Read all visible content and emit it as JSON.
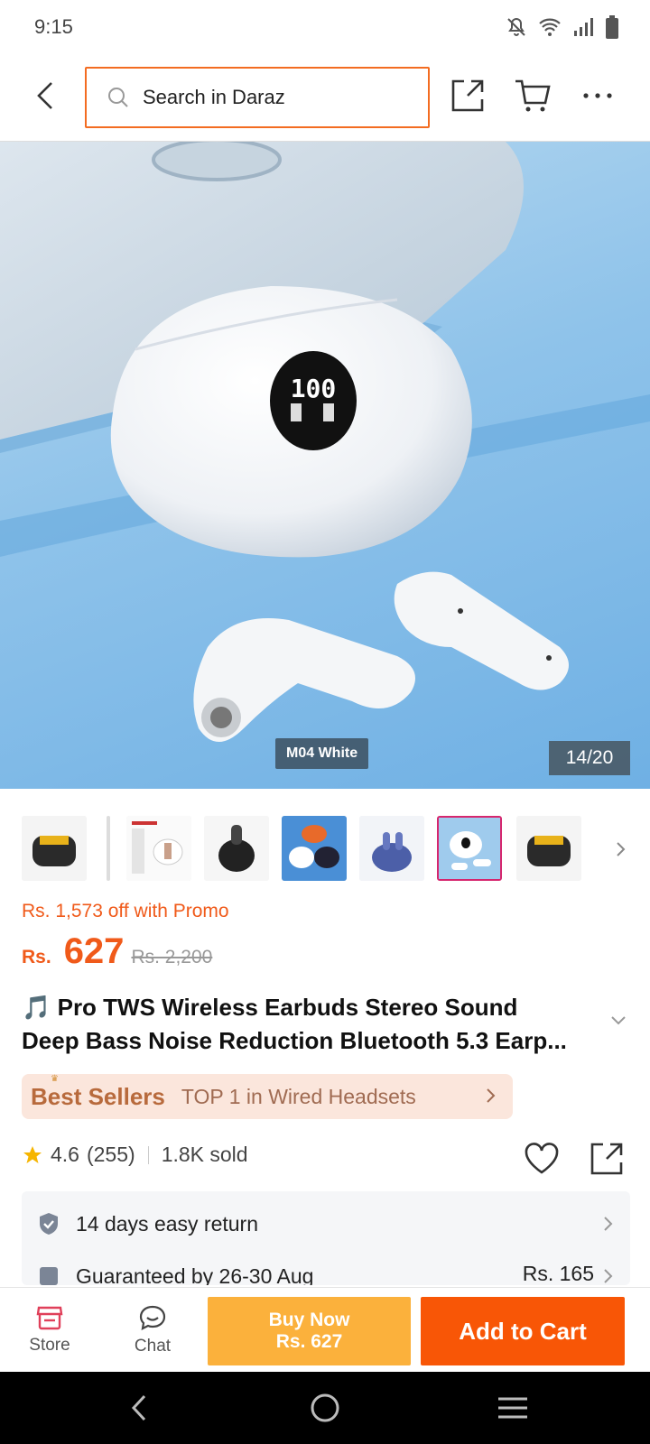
{
  "status_bar": {
    "time": "9:15"
  },
  "search": {
    "placeholder": "Search in Daraz"
  },
  "gallery": {
    "variant_label": "M04 White",
    "counter": "14/20"
  },
  "price": {
    "promo": "Rs. 1,573 off with Promo",
    "currency": "Rs.",
    "current": "627",
    "original": "Rs. 2,200"
  },
  "product": {
    "title_line1": "🎵 Pro TWS Wireless Earbuds Stereo Sound",
    "title_line2": "Deep Bass Noise Reduction Bluetooth 5.3 Earp..."
  },
  "best_seller": {
    "title": "Best Sellers",
    "rank": "TOP 1 in Wired Headsets"
  },
  "rating": {
    "value": "4.6",
    "count": "(255)",
    "sold": "1.8K sold"
  },
  "services": {
    "return": "14 days easy return",
    "delivery": "Guaranteed by 26-30 Aug",
    "fee": "Rs. 165"
  },
  "actions": {
    "store": "Store",
    "chat": "Chat",
    "buy_now_line1": "Buy Now",
    "buy_now_line2": "Rs. 627",
    "add_to_cart": "Add to Cart"
  },
  "colors": {
    "brand_orange": "#f85606",
    "buy_now": "#fbb13c",
    "price": "#f05a1a",
    "selected_thumb": "#d6266e"
  }
}
